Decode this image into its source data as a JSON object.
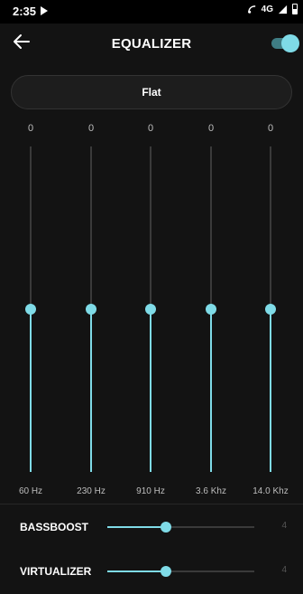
{
  "status_bar": {
    "time": "2:35",
    "network": "4G"
  },
  "header": {
    "title": "EQUALIZER",
    "enabled": true
  },
  "preset": {
    "label": "Flat"
  },
  "bands": [
    {
      "label": "60 Hz",
      "value": "0",
      "level": 0.5
    },
    {
      "label": "230 Hz",
      "value": "0",
      "level": 0.5
    },
    {
      "label": "910 Hz",
      "value": "0",
      "level": 0.5
    },
    {
      "label": "3.6 Khz",
      "value": "0",
      "level": 0.5
    },
    {
      "label": "14.0 Khz",
      "value": "0",
      "level": 0.5
    }
  ],
  "effects": [
    {
      "label": "BASSBOOST",
      "value": "4",
      "level": 0.4
    },
    {
      "label": "VIRTUALIZER",
      "value": "4",
      "level": 0.4
    }
  ],
  "colors": {
    "accent": "#7fdbe7",
    "background": "#131313",
    "status_bar": "#000000"
  }
}
